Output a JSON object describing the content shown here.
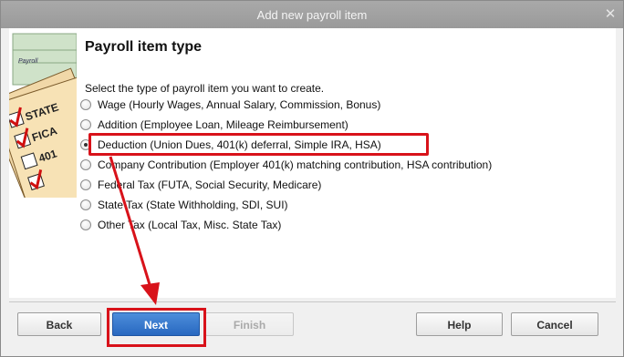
{
  "window": {
    "title": "Add new payroll item"
  },
  "page": {
    "heading": "Payroll item type",
    "prompt": "Select the type of payroll item you want to create."
  },
  "options": [
    {
      "label": "Wage (Hourly Wages, Annual Salary, Commission, Bonus)",
      "selected": false
    },
    {
      "label": "Addition (Employee Loan, Mileage Reimbursement)",
      "selected": false
    },
    {
      "label": "Deduction (Union Dues, 401(k) deferral, Simple IRA, HSA)",
      "selected": true
    },
    {
      "label": "Company Contribution (Employer 401(k) matching contribution, HSA contribution)",
      "selected": false
    },
    {
      "label": "Federal Tax (FUTA, Social Security, Medicare)",
      "selected": false
    },
    {
      "label": "State Tax (State Withholding, SDI, SUI)",
      "selected": false
    },
    {
      "label": "Other Tax (Local Tax, Misc. State Tax)",
      "selected": false
    }
  ],
  "illustration": {
    "labels": [
      "STATE",
      "FICA",
      "401",
      "Payroll"
    ]
  },
  "buttons": {
    "back": "Back",
    "next": "Next",
    "finish": "Finish",
    "help": "Help",
    "cancel": "Cancel"
  },
  "colors": {
    "highlight": "#d8121a",
    "primary_button": "#2f6fc8"
  },
  "icons": {
    "close": "close-icon"
  }
}
